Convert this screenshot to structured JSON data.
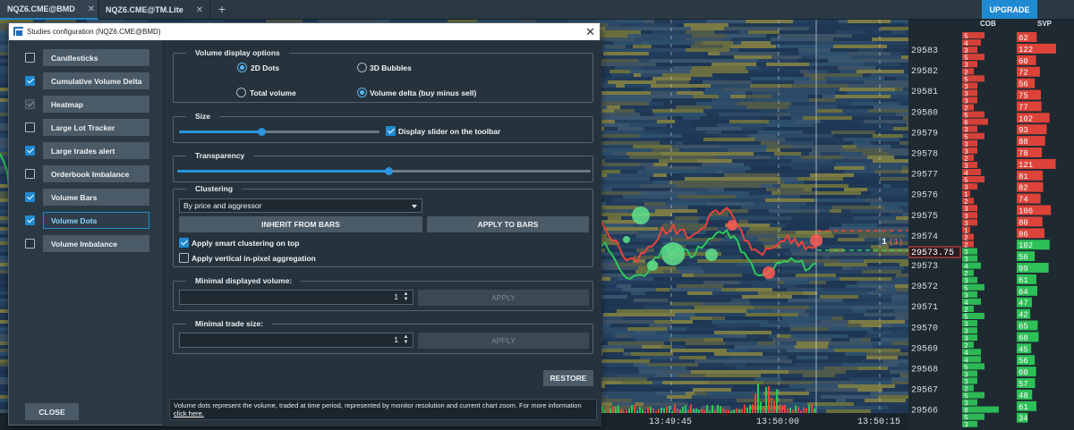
{
  "tabs": [
    {
      "label": "NQZ6.CME@BMD",
      "active": true,
      "close_glyph": "✕"
    },
    {
      "label": "NQZ6.CME@TM.Lite",
      "active": false,
      "close_glyph": "✕"
    }
  ],
  "new_tab_glyph": "+",
  "upgrade_label": "UPGRADE",
  "ladder": {
    "cob_label": "COB",
    "svp_label": "SVP",
    "current_price": "29573.75",
    "order_marker": "1",
    "order_marker_count": "(1)",
    "prices": [
      "29583",
      "29582",
      "29581",
      "29580",
      "29579",
      "29578",
      "29577",
      "29576",
      "29575",
      "29574",
      "29573",
      "29572",
      "29571",
      "29570",
      "29569",
      "29568",
      "29567",
      "29566"
    ],
    "cob_values": [
      "5",
      "4",
      "3",
      "5",
      "3",
      "2",
      "5",
      "3",
      "3",
      "3",
      "2",
      "5",
      "6",
      "3",
      "5",
      "3",
      "3",
      "2",
      "3",
      "4",
      "5",
      "3",
      "1",
      "2",
      "3",
      "3",
      "3",
      "1",
      "2",
      "2",
      "3",
      "3",
      "4",
      "2",
      "3",
      "5",
      "3",
      "4",
      "2",
      "5",
      "3",
      "3",
      "3",
      "2",
      "4",
      "4",
      "5",
      "3",
      "3",
      "2",
      "5",
      "3",
      "9",
      "5",
      "3"
    ],
    "svp_values": [
      "62",
      "122",
      "60",
      "72",
      "56",
      "75",
      "77",
      "102",
      "93",
      "88",
      "78",
      "121",
      "81",
      "82",
      "74",
      "106",
      "80",
      "86",
      "102",
      "56",
      "99",
      "61",
      "64",
      "47",
      "42",
      "65",
      "68",
      "45",
      "56",
      "60",
      "57",
      "48",
      "61",
      "34"
    ],
    "times": [
      "13:49:45",
      "13:50:00",
      "13:50:15"
    ],
    "colors": {
      "bid": "#e8443a",
      "ask": "#2ec85a",
      "price_line": "#e8443a",
      "ask_line": "#2ec85a"
    }
  },
  "dialog": {
    "title": "Studies configuration (NQZ6.CME@BMD)",
    "close_glyph": "✕",
    "studies": [
      {
        "label": "Candlesticks",
        "checked": false,
        "state": "off"
      },
      {
        "label": "Cumulative Volume Delta",
        "checked": true,
        "state": "on"
      },
      {
        "label": "Heatmap",
        "checked": true,
        "state": "dim"
      },
      {
        "label": "Large Lot Tracker",
        "checked": false,
        "state": "off"
      },
      {
        "label": "Large trades alert",
        "checked": true,
        "state": "on"
      },
      {
        "label": "Orderbook Imbalance",
        "checked": false,
        "state": "off"
      },
      {
        "label": "Volume Bars",
        "checked": true,
        "state": "on"
      },
      {
        "label": "Volume Dots",
        "checked": true,
        "state": "on",
        "selected": true
      },
      {
        "label": "Volume Imbalance",
        "checked": false,
        "state": "off"
      }
    ],
    "close_label": "CLOSE",
    "volume_display": {
      "legend": "Volume display options",
      "opt_2d": "2D Dots",
      "opt_3d": "3D Bubbles",
      "opt_total": "Total volume",
      "opt_delta": "Volume delta (buy minus sell)",
      "selected_shape": "2D Dots",
      "selected_mode": "Volume delta (buy minus sell)"
    },
    "size": {
      "legend": "Size",
      "value": 0.41,
      "toolbar_label": "Display slider on the toolbar",
      "toolbar_checked": true
    },
    "transparency": {
      "legend": "Transparency",
      "value": 0.51
    },
    "clustering": {
      "legend": "Clustering",
      "selected": "By price and aggressor",
      "inherit_label": "INHERIT FROM BARS",
      "apply_label": "APPLY TO BARS",
      "smart_label": "Apply smart clustering on top",
      "smart_checked": true,
      "vertical_label": "Apply vertical in-pixel aggregation",
      "vertical_checked": false
    },
    "min_volume": {
      "legend": "Minimal displayed volume:",
      "value": "1",
      "apply_label": "APPLY"
    },
    "min_trade": {
      "legend": "Minimal trade size:",
      "value": "1",
      "apply_label": "APPLY"
    },
    "restore_label": "RESTORE",
    "info_text": "Volume dots represent the volume, traded at time period, represented by monitor resolution and current chart zoom. For more information",
    "info_link": "click here."
  }
}
